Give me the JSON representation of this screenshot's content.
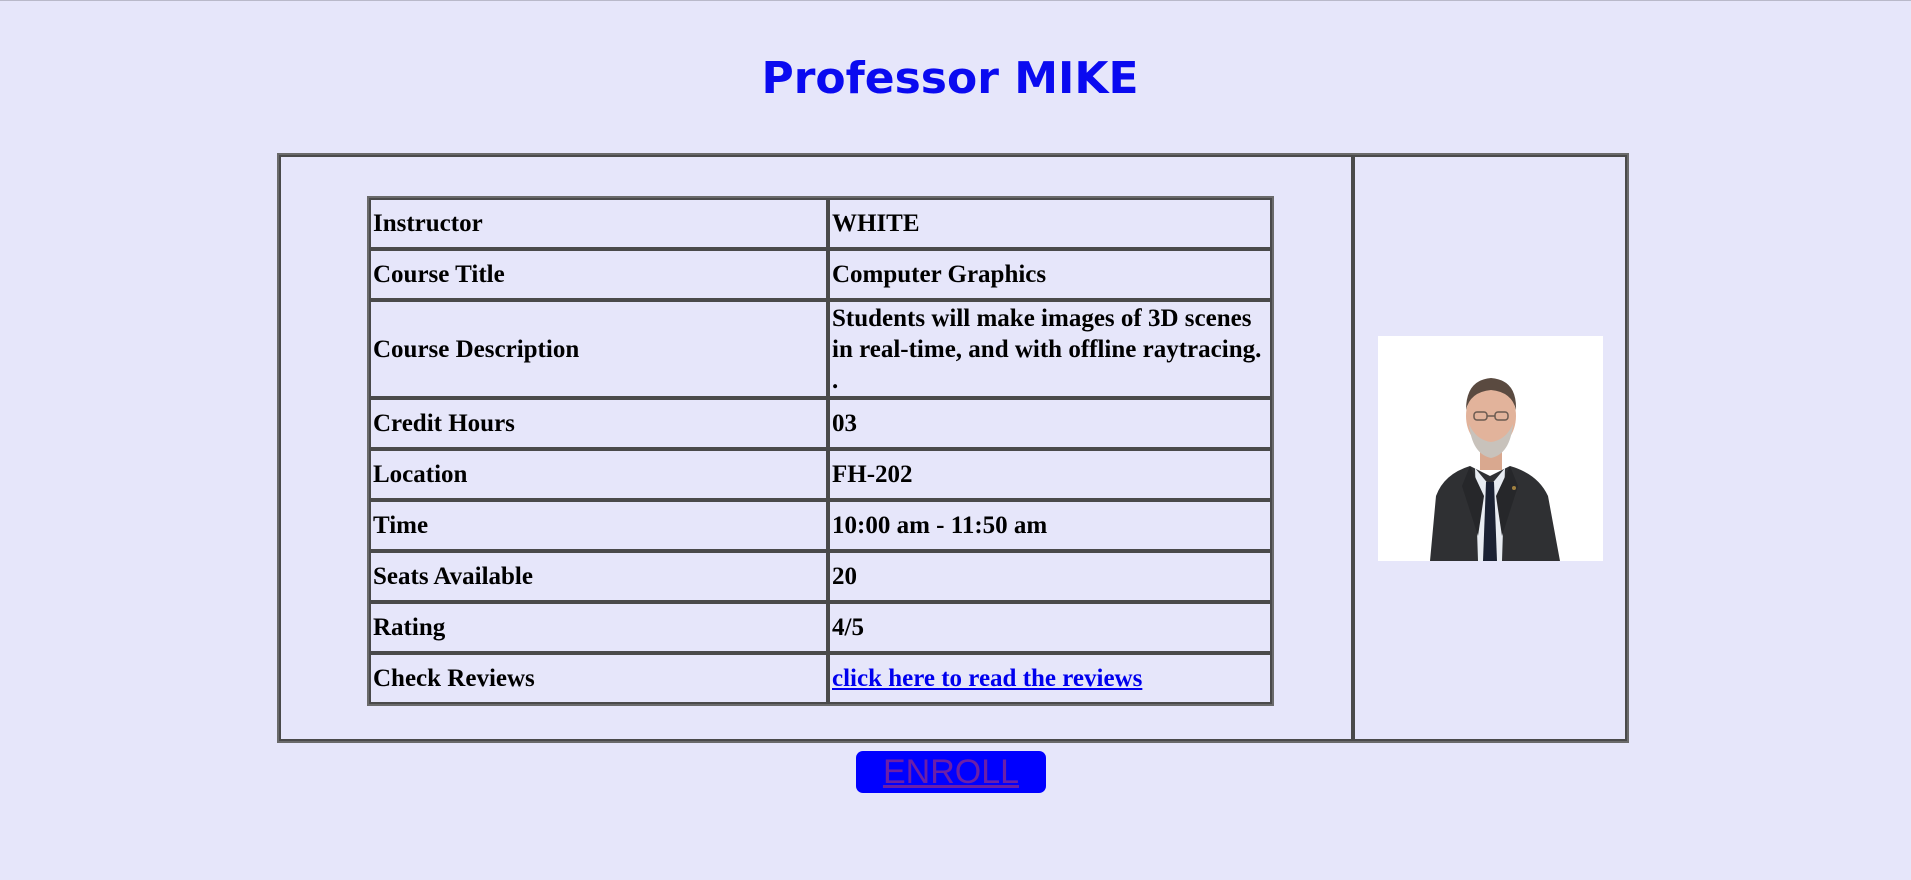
{
  "page": {
    "title": "Professor MIKE"
  },
  "course": {
    "rows": [
      {
        "label": "Instructor",
        "value": "WHITE"
      },
      {
        "label": "Course Title",
        "value": "Computer Graphics"
      },
      {
        "label": "Course Description",
        "value": "Students will make images of 3D scenes in real-time, and with offline raytracing. ."
      },
      {
        "label": "Credit Hours",
        "value": "03"
      },
      {
        "label": "Location",
        "value": "FH-202"
      },
      {
        "label": "Time",
        "value": "10:00 am - 11:50 am"
      },
      {
        "label": "Seats Available",
        "value": "20"
      },
      {
        "label": "Rating",
        "value": "4/5"
      },
      {
        "label": "Check Reviews",
        "value": "click here to read the reviews"
      }
    ]
  },
  "actions": {
    "enroll_label": "ENROLL"
  },
  "colors": {
    "background": "#e6e6fa",
    "title": "#0a0af0",
    "enroll_button": "#0000ff",
    "link": "#0000ee"
  }
}
